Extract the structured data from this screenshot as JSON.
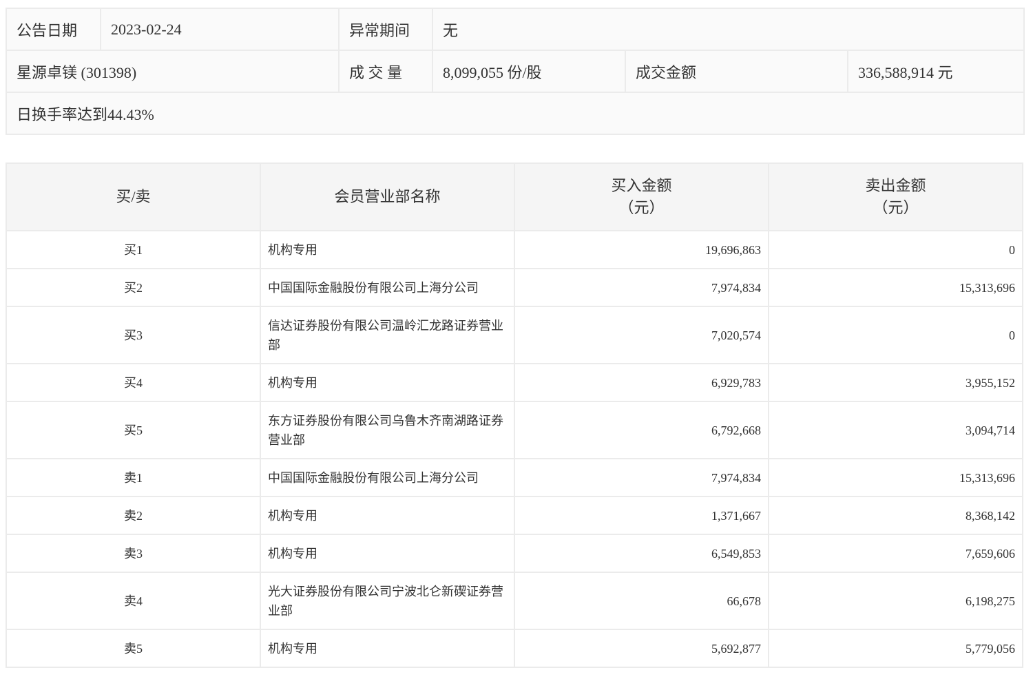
{
  "info": {
    "date_label": "公告日期",
    "date_value": "2023-02-24",
    "period_label": "异常期间",
    "period_value": "无",
    "stock": "星源卓镁 (301398)",
    "volume_label": "成 交 量",
    "volume_value": "8,099,055 份/股",
    "amount_label": "成交金额",
    "amount_value": "336,588,914 元",
    "reason": "日换手率达到44.43%"
  },
  "table": {
    "headers": [
      "买/卖",
      "会员营业部名称",
      "买入金额",
      "（元）",
      "卖出金额",
      "（元）"
    ],
    "rows": [
      {
        "side": "买1",
        "name": "机构专用",
        "buy": "19,696,863",
        "sell": "0"
      },
      {
        "side": "买2",
        "name": "中国国际金融股份有限公司上海分公司",
        "buy": "7,974,834",
        "sell": "15,313,696"
      },
      {
        "side": "买3",
        "name": "信达证券股份有限公司温岭汇龙路证券营业部",
        "buy": "7,020,574",
        "sell": "0"
      },
      {
        "side": "买4",
        "name": "机构专用",
        "buy": "6,929,783",
        "sell": "3,955,152"
      },
      {
        "side": "买5",
        "name": "东方证券股份有限公司乌鲁木齐南湖路证券营业部",
        "buy": "6,792,668",
        "sell": "3,094,714"
      },
      {
        "side": "卖1",
        "name": "中国国际金融股份有限公司上海分公司",
        "buy": "7,974,834",
        "sell": "15,313,696"
      },
      {
        "side": "卖2",
        "name": "机构专用",
        "buy": "1,371,667",
        "sell": "8,368,142"
      },
      {
        "side": "卖3",
        "name": "机构专用",
        "buy": "6,549,853",
        "sell": "7,659,606"
      },
      {
        "side": "卖4",
        "name": "光大证券股份有限公司宁波北仑新碶证券营业部",
        "buy": "66,678",
        "sell": "6,198,275"
      },
      {
        "side": "卖5",
        "name": "机构专用",
        "buy": "5,692,877",
        "sell": "5,779,056"
      }
    ]
  }
}
